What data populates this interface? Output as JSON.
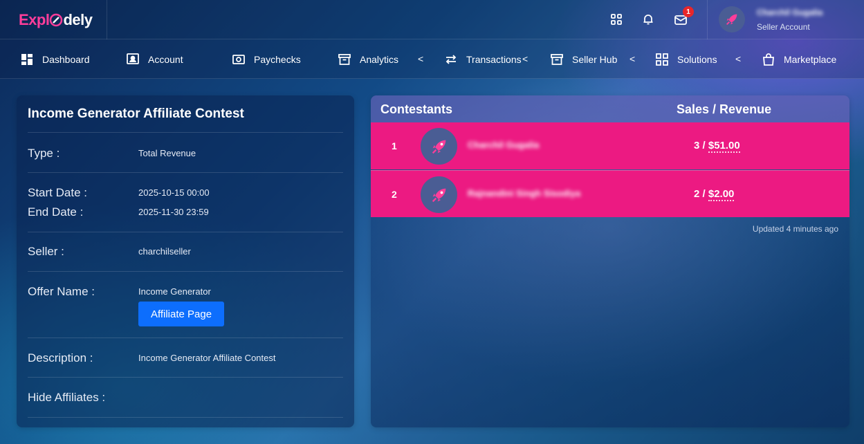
{
  "brand": {
    "logo_part1": "Expl",
    "logo_part2": "dely",
    "colors": {
      "pink": "#ff3d9a",
      "row": "#ec1a82",
      "button": "#0d6efd"
    }
  },
  "topbar": {
    "icons": [
      "apps-grid-icon",
      "bell-icon",
      "mail-icon"
    ],
    "mail_badge": "1",
    "user": {
      "name": "Charchil Gugalia",
      "role": "Seller Account"
    }
  },
  "nav": {
    "items": [
      {
        "label": "Dashboard",
        "icon": "dashboard-icon"
      },
      {
        "label": "Account",
        "icon": "account-icon"
      },
      {
        "label": "Paychecks",
        "icon": "paychecks-icon"
      },
      {
        "label": "Analytics",
        "icon": "analytics-icon",
        "chevron": "<"
      },
      {
        "label": "Transactions",
        "icon": "transactions-icon",
        "chevron": "<"
      },
      {
        "label": "Seller Hub",
        "icon": "seller-hub-icon",
        "chevron": "<"
      },
      {
        "label": "Solutions",
        "icon": "solutions-icon",
        "chevron": "<"
      },
      {
        "label": "Marketplace",
        "icon": "marketplace-icon"
      }
    ]
  },
  "contest": {
    "title": "Income Generator Affiliate Contest",
    "type_label": "Type :",
    "type_value": "Total Revenue",
    "start_label": "Start Date :",
    "start_value": "2025-10-15 00:00",
    "end_label": "End Date :",
    "end_value": "2025-11-30 23:59",
    "seller_label": "Seller :",
    "seller_value": "charchilseller",
    "offer_label": "Offer Name :",
    "offer_value": "Income Generator",
    "affiliate_button": "Affiliate Page",
    "description_label": "Description :",
    "description_value": "Income Generator Affiliate Contest",
    "hide_label": "Hide Affiliates :"
  },
  "leaderboard": {
    "header_left": "Contestants",
    "header_right": "Sales / Revenue",
    "rows": [
      {
        "rank": "1",
        "name": "Charchil Gugalia",
        "sales": "3",
        "revenue": "$51.00"
      },
      {
        "rank": "2",
        "name": "Rajnandini Singh Sisodiya",
        "sales": "2",
        "revenue": "$2.00"
      }
    ],
    "updated": "Updated 4 minutes ago"
  }
}
